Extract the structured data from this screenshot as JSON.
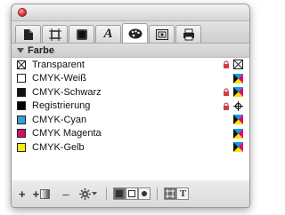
{
  "panel": {
    "section_title": "Farbe"
  },
  "tabs": [
    {
      "icon": "page-icon",
      "active": false
    },
    {
      "icon": "frame-icon",
      "active": false
    },
    {
      "icon": "object-style-icon",
      "active": false
    },
    {
      "icon": "character-icon",
      "label": "A",
      "active": false
    },
    {
      "icon": "color-palette-icon",
      "active": true
    },
    {
      "icon": "image-icon",
      "active": false
    },
    {
      "icon": "print-icon",
      "active": false
    }
  ],
  "colors": [
    {
      "name": "Transparent",
      "swatch": "transparent",
      "locked": true,
      "mode": "none"
    },
    {
      "name": "CMYK-Weiß",
      "swatch": "#ffffff",
      "locked": false,
      "mode": "cmyk"
    },
    {
      "name": "CMYK-Schwarz",
      "swatch": "#111111",
      "locked": true,
      "mode": "cmyk"
    },
    {
      "name": "Registrierung",
      "swatch": "#000000",
      "locked": true,
      "mode": "registration"
    },
    {
      "name": "CMYK-Cyan",
      "swatch": "#3a9fd6",
      "locked": false,
      "mode": "cmyk"
    },
    {
      "name": "CMYK Magenta",
      "swatch": "#c8156b",
      "locked": false,
      "mode": "cmyk"
    },
    {
      "name": "CMYK-Gelb",
      "swatch": "#f5ec12",
      "locked": false,
      "mode": "cmyk"
    }
  ],
  "footer": {
    "add_label": "+",
    "add_gradient_label": "+",
    "delete_label": "–"
  }
}
